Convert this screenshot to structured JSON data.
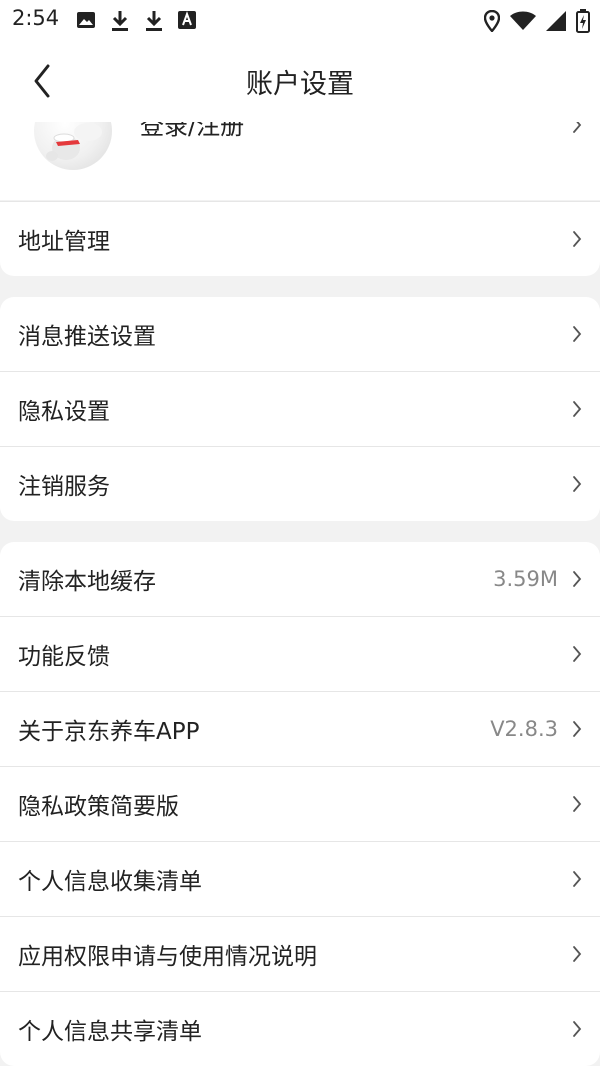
{
  "status_bar": {
    "time": "2:54"
  },
  "header": {
    "title": "账户设置",
    "back_icon": "chevron-left-icon"
  },
  "profile": {
    "label": "登录/注册"
  },
  "group1": [
    {
      "label": "地址管理"
    }
  ],
  "group2": [
    {
      "label": "消息推送设置"
    },
    {
      "label": "隐私设置"
    },
    {
      "label": "注销服务"
    }
  ],
  "group3": [
    {
      "label": "清除本地缓存",
      "value": "3.59M"
    },
    {
      "label": "功能反馈"
    },
    {
      "label": "关于京东养车APP",
      "value": "V2.8.3"
    },
    {
      "label": "隐私政策简要版"
    },
    {
      "label": "个人信息收集清单"
    },
    {
      "label": "应用权限申请与使用情况说明"
    },
    {
      "label": "个人信息共享清单"
    }
  ],
  "colors": {
    "background": "#f2f2f2",
    "card": "#ffffff",
    "divider": "#e6e6e6",
    "secondary_text": "#888888",
    "accent": "#e4393c"
  }
}
